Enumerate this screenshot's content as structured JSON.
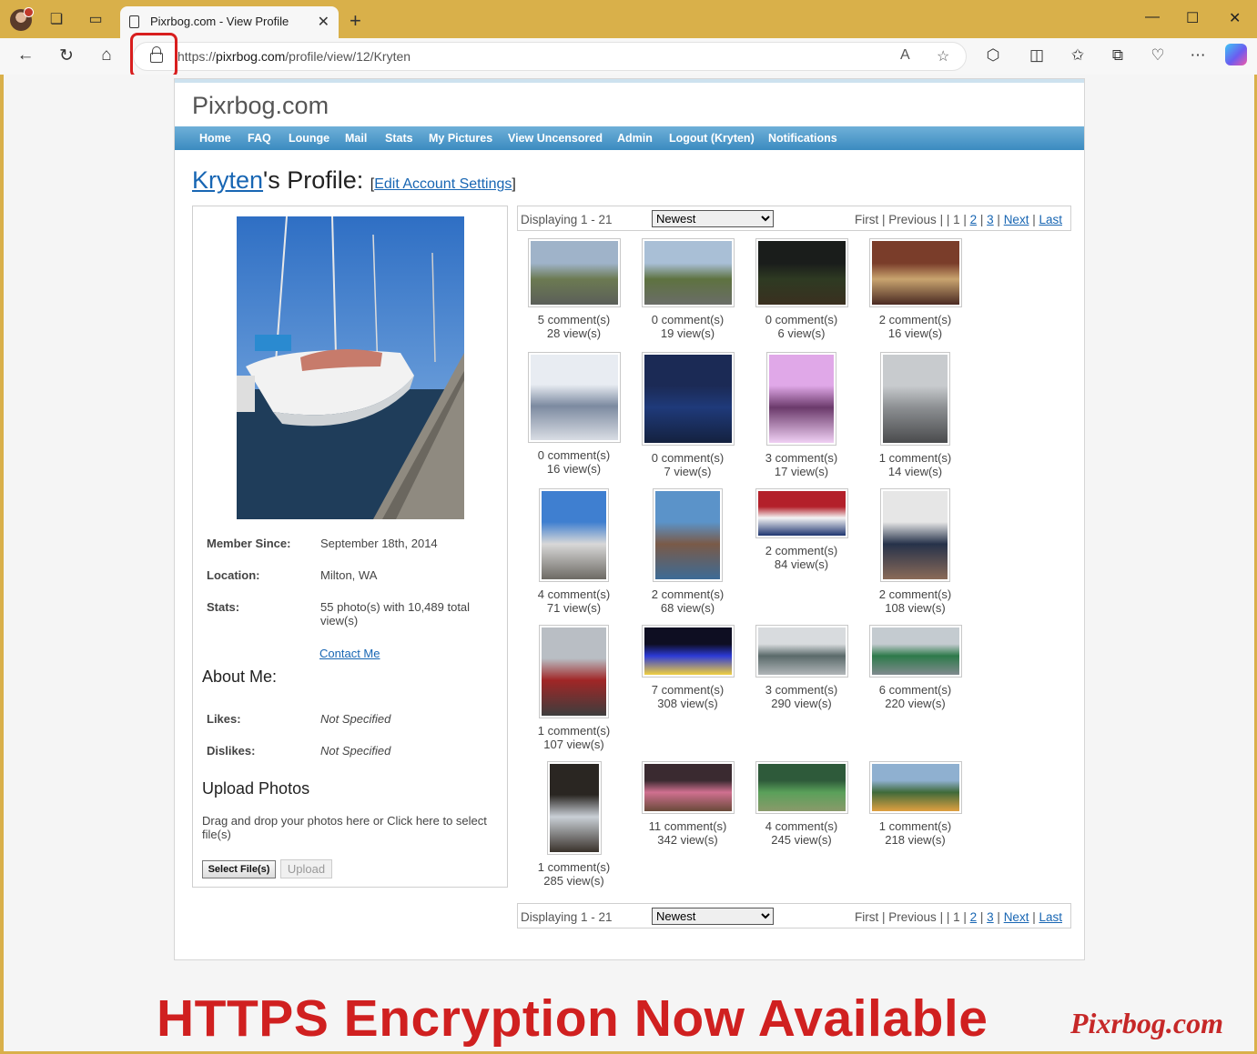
{
  "browser": {
    "tab_title": "Pixrbog.com - View Profile",
    "url_prefix": "https://",
    "url_host": "pixrbog.com",
    "url_path": "/profile/view/12/Kryten"
  },
  "site": {
    "logo": "Pixrbog.com",
    "menu": [
      "Home",
      "FAQ",
      "Lounge",
      "Mail",
      "Stats",
      "My Pictures",
      "View Uncensored",
      "Admin",
      "Logout (Kryten)",
      "Notifications"
    ]
  },
  "profile": {
    "username": "Kryten",
    "title_suffix": "'s Profile: ",
    "bracket_open": "[",
    "bracket_close": "]",
    "edit_link": "Edit Account Settings",
    "member_since_label": "Member Since:",
    "member_since": "September 18th, 2014",
    "location_label": "Location:",
    "location": "Milton, WA",
    "stats_label": "Stats:",
    "stats": "55 photo(s) with 10,489 total view(s)",
    "contact": "Contact Me",
    "about_heading": "About Me:",
    "likes_label": "Likes:",
    "likes": "Not Specified",
    "dislikes_label": "Dislikes:",
    "dislikes": "Not Specified",
    "upload_heading": "Upload Photos",
    "upload_text": "Drag and drop your photos here or Click here to select file(s)",
    "select_button": "Select File(s)",
    "upload_button": "Upload"
  },
  "pager": {
    "displaying": "Displaying 1 - 21",
    "sort_selected": "Newest",
    "first": "First",
    "previous": "Previous",
    "current": "1",
    "page2": "2",
    "page3": "3",
    "next": "Next",
    "last": "Last"
  },
  "photos": [
    {
      "comments": "5 comment(s)",
      "views": "28 view(s)",
      "colors": [
        "#9fb3c9",
        "#6c7a52",
        "#5b5f59"
      ]
    },
    {
      "comments": "0 comment(s)",
      "views": "19 view(s)",
      "colors": [
        "#a9bfd6",
        "#5e7240",
        "#6a6d68"
      ]
    },
    {
      "comments": "0 comment(s)",
      "views": "6 view(s)",
      "colors": [
        "#1a1d1b",
        "#2e3a22",
        "#3a3020"
      ]
    },
    {
      "comments": "2 comment(s)",
      "views": "16 view(s)",
      "colors": [
        "#7a3d2a",
        "#c9a46f",
        "#4a2a22"
      ]
    },
    {
      "comments": "0 comment(s)",
      "views": "16 view(s)",
      "colors": [
        "#e8ecf2",
        "#7c8aa0",
        "#d9dde4"
      ]
    },
    {
      "comments": "0 comment(s)",
      "views": "7 view(s)",
      "colors": [
        "#1b2a55",
        "#1f3a7a",
        "#14213f"
      ]
    },
    {
      "comments": "3 comment(s)",
      "views": "17 view(s)",
      "colors": [
        "#e0a8e8",
        "#6b3a6b",
        "#f0d0f4"
      ]
    },
    {
      "comments": "1 comment(s)",
      "views": "14 view(s)",
      "colors": [
        "#c8cbce",
        "#8c8f92",
        "#4a4b4d"
      ]
    },
    {
      "comments": "4 comment(s)",
      "views": "71 view(s)",
      "colors": [
        "#3f7fd0",
        "#d8d8d8",
        "#6d6a64"
      ]
    },
    {
      "comments": "2 comment(s)",
      "views": "68 view(s)",
      "colors": [
        "#5b93c9",
        "#7a5a48",
        "#3d6b96"
      ]
    },
    {
      "comments": "2 comment(s)",
      "views": "84 view(s)",
      "colors": [
        "#b3202a",
        "#f4f4f4",
        "#1e3570"
      ]
    },
    {
      "comments": "2 comment(s)",
      "views": "108 view(s)",
      "colors": [
        "#e6e6e6",
        "#26324a",
        "#8a6a58"
      ]
    },
    {
      "comments": "1 comment(s)",
      "views": "107 view(s)",
      "colors": [
        "#b9bec4",
        "#a02626",
        "#3d3d3d"
      ]
    },
    {
      "comments": "7 comment(s)",
      "views": "308 view(s)",
      "colors": [
        "#0e0e22",
        "#2c3ad6",
        "#f0d040"
      ]
    },
    {
      "comments": "3 comment(s)",
      "views": "290 view(s)",
      "colors": [
        "#d8dbde",
        "#5a6a6a",
        "#b0b5b8"
      ]
    },
    {
      "comments": "6 comment(s)",
      "views": "220 view(s)",
      "colors": [
        "#c4cbd0",
        "#2d7a4a",
        "#808a8e"
      ]
    },
    {
      "comments": "1 comment(s)",
      "views": "285 view(s)",
      "colors": [
        "#2a2622",
        "#c9cfd6",
        "#3a332c"
      ]
    },
    {
      "comments": "11 comment(s)",
      "views": "342 view(s)",
      "colors": [
        "#3a2a30",
        "#d07090",
        "#6a4a3a"
      ]
    },
    {
      "comments": "4 comment(s)",
      "views": "245 view(s)",
      "colors": [
        "#2e5a3a",
        "#5aa05a",
        "#8a9a6a"
      ]
    },
    {
      "comments": "1 comment(s)",
      "views": "218 view(s)",
      "colors": [
        "#8fb0d0",
        "#3f6a3a",
        "#e0a040"
      ]
    }
  ],
  "promo": {
    "headline": "HTTPS Encryption Now Available",
    "brand": "Pixrbog.com"
  },
  "colors": {
    "menu_bar": "#3b8bc0",
    "link": "#1866b3",
    "promo": "#d02020",
    "highlight": "#d81e1e"
  }
}
